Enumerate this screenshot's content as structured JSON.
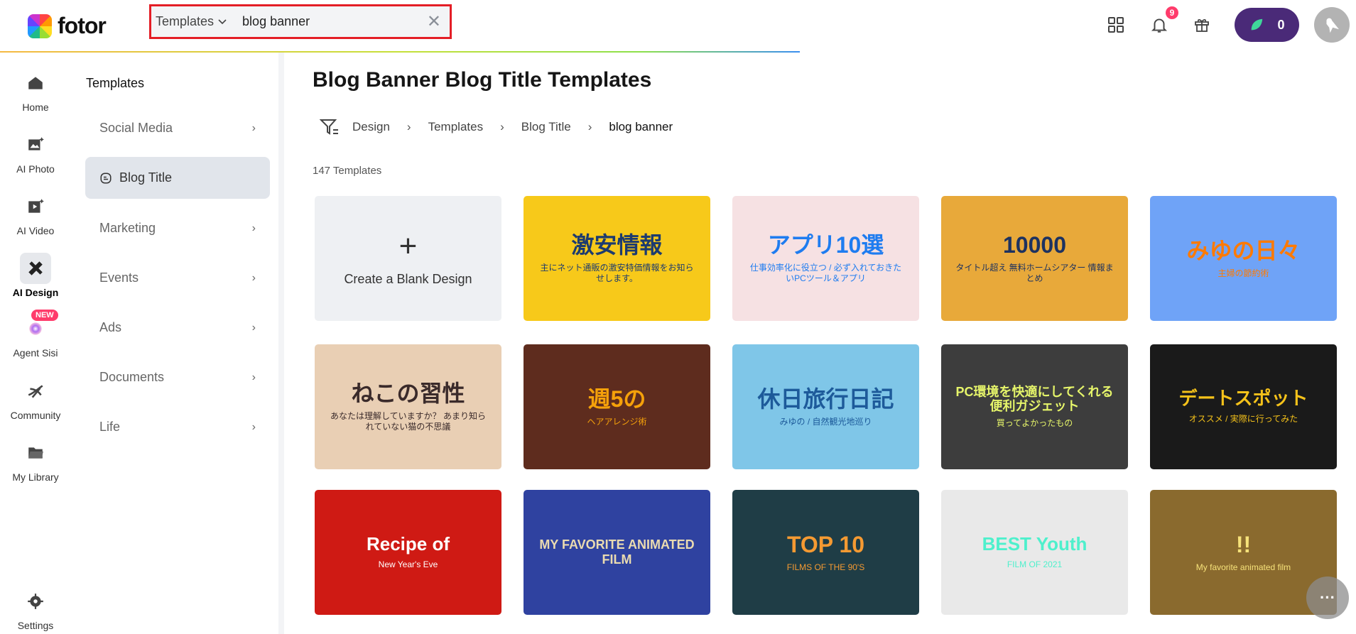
{
  "header": {
    "logo_text": "fotor",
    "search": {
      "scope": "Templates",
      "value": "blog banner",
      "placeholder": ""
    },
    "notifications_count": "9",
    "credits": "0"
  },
  "rail": [
    {
      "label": "Home",
      "icon": "home-icon"
    },
    {
      "label": "AI Photo",
      "icon": "ai-photo-icon"
    },
    {
      "label": "AI Video",
      "icon": "ai-video-icon"
    },
    {
      "label": "AI Design",
      "icon": "ai-design-icon",
      "active": true
    },
    {
      "label": "Agent Sisi",
      "icon": "agent-sisi-icon",
      "badge": "NEW"
    },
    {
      "label": "Community",
      "icon": "community-icon"
    },
    {
      "label": "My Library",
      "icon": "folder-icon"
    },
    {
      "label": "Settings",
      "icon": "gear-icon"
    }
  ],
  "panel": {
    "heading": "Templates",
    "categories": [
      {
        "label": "Social Media"
      },
      {
        "label": "Blog Title",
        "active": true
      },
      {
        "label": "Marketing"
      },
      {
        "label": "Events"
      },
      {
        "label": "Ads"
      },
      {
        "label": "Documents"
      },
      {
        "label": "Life"
      }
    ]
  },
  "main": {
    "title": "Blog Banner Blog Title Templates",
    "breadcrumb": [
      "Design",
      "Templates",
      "Blog Title",
      "blog banner"
    ],
    "count": "147 Templates",
    "blank_label": "Create a Blank Design",
    "blank_plus": "+",
    "templates": [
      {
        "t1": "激安情報",
        "t2": "主にネット通販の激安特価情報をお知らせします。",
        "bg": "#f7c91a",
        "fg": "#1d3b6f"
      },
      {
        "t1": "アプリ10選",
        "t2": "仕事効率化に役立つ / 必ず入れておきたいPCツール＆アプリ",
        "bg": "#f6e1e3",
        "fg": "#1e7cf0"
      },
      {
        "t1": "10000",
        "t2": "タイトル超え 無料ホームシアター 情報まとめ",
        "bg": "#e8a93a",
        "fg": "#1d3260"
      },
      {
        "t1": "みゆの日々",
        "t2": "主婦の節約術",
        "bg": "#6fa3f7",
        "fg": "#ff7a00"
      },
      {
        "t1": "ねこの習性",
        "t2": "あなたは理解していますか？ あまり知られていない猫の不思議",
        "bg": "#e9cfb4",
        "fg": "#3a2a2a"
      },
      {
        "t1": "週5の",
        "t2": "ヘアアレンジ術",
        "bg": "#5e2c1e",
        "fg": "#f5a10a"
      },
      {
        "t1": "休日旅行日記",
        "t2": "みゆの / 自然観光地巡り",
        "bg": "#7fc6e8",
        "fg": "#1d5a9a"
      },
      {
        "t1": "PC環境を快適にしてくれる便利ガジェット",
        "t2": "買ってよかったもの",
        "bg": "#3d3d3d",
        "fg": "#e6f56a"
      },
      {
        "t1": "デートスポット",
        "t2": "オススメ / 実際に行ってみた",
        "bg": "#1a1a1a",
        "fg": "#f5c21a"
      },
      {
        "t1": "Recipe of",
        "t2": "New Year's Eve",
        "bg": "#cf1a14",
        "fg": "#ffffff"
      },
      {
        "t1": "MY FAVORITE ANIMATED FILM",
        "t2": "",
        "bg": "#2f42a0",
        "fg": "#eadbb0"
      },
      {
        "t1": "TOP 10",
        "t2": "FILMS OF THE 90'S",
        "bg": "#1f3d46",
        "fg": "#f59a32"
      },
      {
        "t1": "BEST Youth",
        "t2": "FILM OF 2021",
        "bg": "#e9e9e9",
        "fg": "#4ef0cc"
      },
      {
        "t1": "!!",
        "t2": "My favorite animated film",
        "bg": "#8a6a2e",
        "fg": "#f6e27a"
      }
    ]
  }
}
